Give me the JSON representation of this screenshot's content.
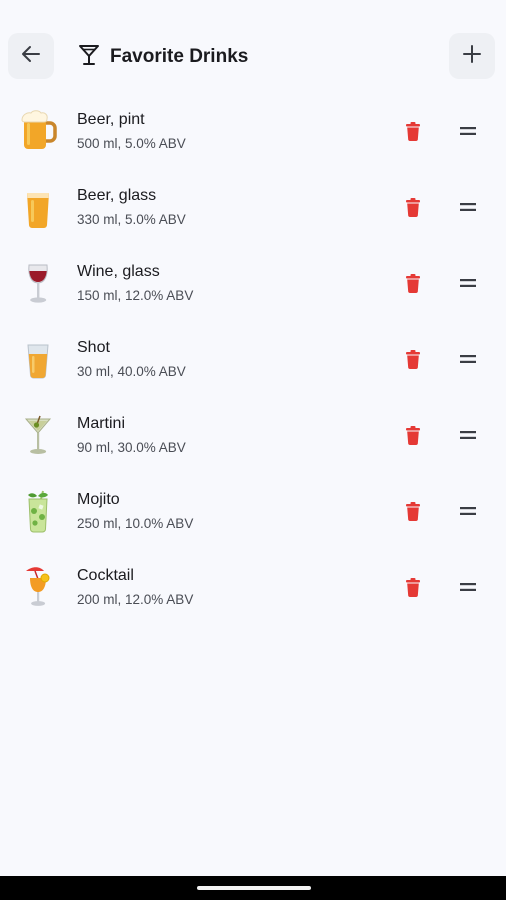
{
  "header": {
    "title": "Favorite Drinks",
    "back_icon": "arrow-left-icon",
    "title_icon": "cocktail-glass-icon",
    "add_icon": "plus-icon"
  },
  "drinks": [
    {
      "name": "Beer, pint",
      "detail": "500 ml, 5.0% ABV",
      "icon": "beer-mug-icon"
    },
    {
      "name": "Beer, glass",
      "detail": "330 ml, 5.0% ABV",
      "icon": "beer-glass-icon"
    },
    {
      "name": "Wine, glass",
      "detail": "150 ml, 12.0% ABV",
      "icon": "wine-glass-icon"
    },
    {
      "name": "Shot",
      "detail": "30 ml, 40.0% ABV",
      "icon": "shot-glass-icon"
    },
    {
      "name": "Martini",
      "detail": "90 ml, 30.0% ABV",
      "icon": "martini-icon"
    },
    {
      "name": "Mojito",
      "detail": "250 ml, 10.0% ABV",
      "icon": "mojito-icon"
    },
    {
      "name": "Cocktail",
      "detail": "200 ml, 12.0% ABV",
      "icon": "tropical-cocktail-icon"
    }
  ],
  "colors": {
    "background": "#f8f9fd",
    "delete": "#e53935",
    "button_bg": "#eef0f4"
  }
}
